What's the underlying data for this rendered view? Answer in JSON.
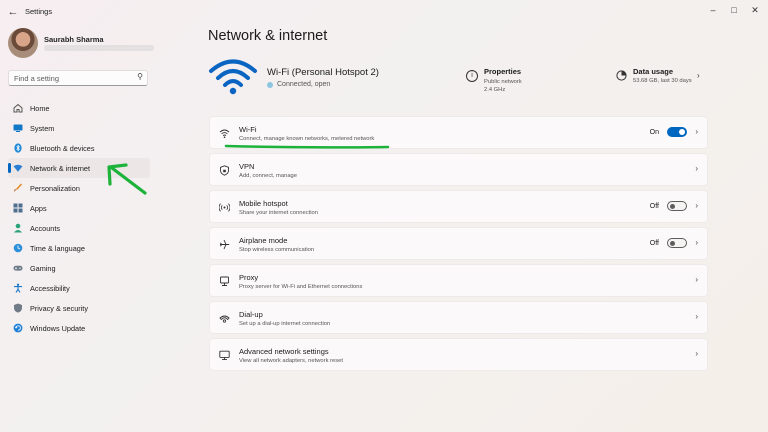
{
  "window": {
    "title": "Settings",
    "back_icon": "back-arrow-icon",
    "controls": [
      "minimize-icon",
      "maximize-icon",
      "close-icon"
    ]
  },
  "user": {
    "name": "Saurabh Sharma"
  },
  "search": {
    "placeholder": "Find a setting",
    "icon": "search-icon"
  },
  "sidebar": {
    "accent": "#0067c0",
    "items": [
      {
        "label": "Home",
        "icon": "home-icon"
      },
      {
        "label": "System",
        "icon": "monitor-icon"
      },
      {
        "label": "Bluetooth & devices",
        "icon": "bluetooth-icon"
      },
      {
        "label": "Network & internet",
        "icon": "wifi-diamond-icon",
        "active": true
      },
      {
        "label": "Personalization",
        "icon": "brush-icon"
      },
      {
        "label": "Apps",
        "icon": "apps-grid-icon"
      },
      {
        "label": "Accounts",
        "icon": "person-icon"
      },
      {
        "label": "Time & language",
        "icon": "globe-clock-icon"
      },
      {
        "label": "Gaming",
        "icon": "gamepad-icon"
      },
      {
        "label": "Accessibility",
        "icon": "accessibility-icon"
      },
      {
        "label": "Privacy & security",
        "icon": "shield-icon"
      },
      {
        "label": "Windows Update",
        "icon": "update-icon"
      }
    ]
  },
  "page": {
    "title": "Network & internet"
  },
  "connection": {
    "name": "Wi-Fi (Personal Hotspot  2)",
    "status": "Connected, open",
    "properties": {
      "title": "Properties",
      "line1": "Public network",
      "line2": "2.4 GHz"
    },
    "data_usage": {
      "title": "Data usage",
      "detail": "53.68 GB, last 30 days"
    }
  },
  "settings": [
    {
      "title": "Wi-Fi",
      "subtitle": "Connect, manage known networks, metered network",
      "state": "On",
      "toggle": "on",
      "icon": "wifi-icon"
    },
    {
      "title": "VPN",
      "subtitle": "Add, connect, manage",
      "state": "",
      "toggle": "none",
      "icon": "vpn-shield-icon"
    },
    {
      "title": "Mobile hotspot",
      "subtitle": "Share your internet connection",
      "state": "Off",
      "toggle": "off",
      "icon": "hotspot-icon"
    },
    {
      "title": "Airplane mode",
      "subtitle": "Stop wireless communication",
      "state": "Off",
      "toggle": "off",
      "icon": "airplane-icon"
    },
    {
      "title": "Proxy",
      "subtitle": "Proxy server for Wi-Fi and Ethernet connections",
      "state": "",
      "toggle": "none",
      "icon": "proxy-icon"
    },
    {
      "title": "Dial-up",
      "subtitle": "Set up a dial-up internet connection",
      "state": "",
      "toggle": "none",
      "icon": "dialup-icon"
    },
    {
      "title": "Advanced network settings",
      "subtitle": "View all network adapters, network reset",
      "state": "",
      "toggle": "none",
      "icon": "advanced-network-icon"
    }
  ],
  "annotations": {
    "color": "#1db33a",
    "arrow": "arrow-pointing-to-network-internet",
    "underline": "underline-under-wifi-row"
  }
}
